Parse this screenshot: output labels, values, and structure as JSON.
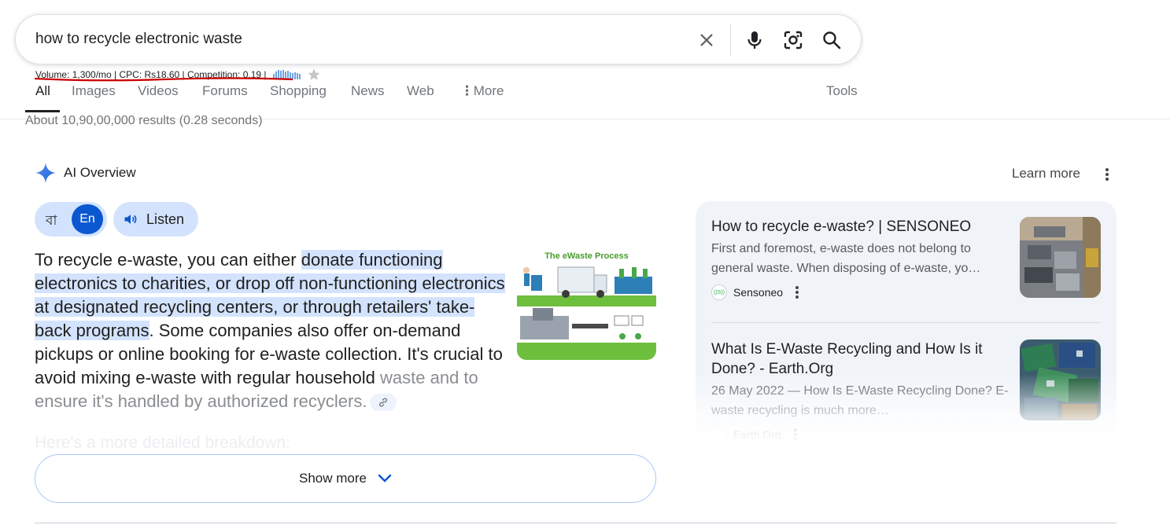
{
  "search": {
    "query": "how to recycle electronic waste"
  },
  "keyword_stats": {
    "text": "Volume: 1,300/mo | CPC: Rs18.60 | Competition: 0.19 |"
  },
  "tabs": [
    {
      "label": "All"
    },
    {
      "label": "Images"
    },
    {
      "label": "Videos"
    },
    {
      "label": "Forums"
    },
    {
      "label": "Shopping"
    },
    {
      "label": "News"
    },
    {
      "label": "Web"
    },
    {
      "label": "More"
    }
  ],
  "tools_label": "Tools",
  "results_count": "About 10,90,00,000 results (0.28 seconds)",
  "ai_overview": {
    "title": "AI Overview",
    "learn_more": "Learn more",
    "lang_bn": "বা",
    "lang_en": "En",
    "listen": "Listen",
    "text_intro": "To recycle e-waste, you can either ",
    "text_highlight": "donate functioning electronics to charities, or drop off non-functioning electronics at designated recycling centers, or through retailers' take-back programs",
    "text_rest": ". Some companies also offer on-demand pickups or online booking for e-waste collection. It's crucial to avoid mixing e-waste with regular household ",
    "text_faded": "waste and to ensure it's handled by authorized recyclers.",
    "ghost_text": "Here's a more detailed breakdown:",
    "image_title": "The eWaste Process",
    "show_more": "Show more"
  },
  "sources": [
    {
      "title": "How to recycle e-waste? | SENSONEO",
      "snippet": "First and foremost, e-waste does not belong to general waste. When disposing of e-waste, yo…",
      "site": "Sensoneo"
    },
    {
      "title": "What Is E-Waste Recycling and How Is it Done? - Earth.Org",
      "snippet": "26 May 2022 — How Is E-Waste Recycling Done? E-waste recycling is much more…",
      "site": "Earth.Org"
    }
  ],
  "colors": {
    "highlight": "#d3e3fd",
    "accent_blue": "#0b57d0",
    "source_panel": "#f0f4f9"
  }
}
